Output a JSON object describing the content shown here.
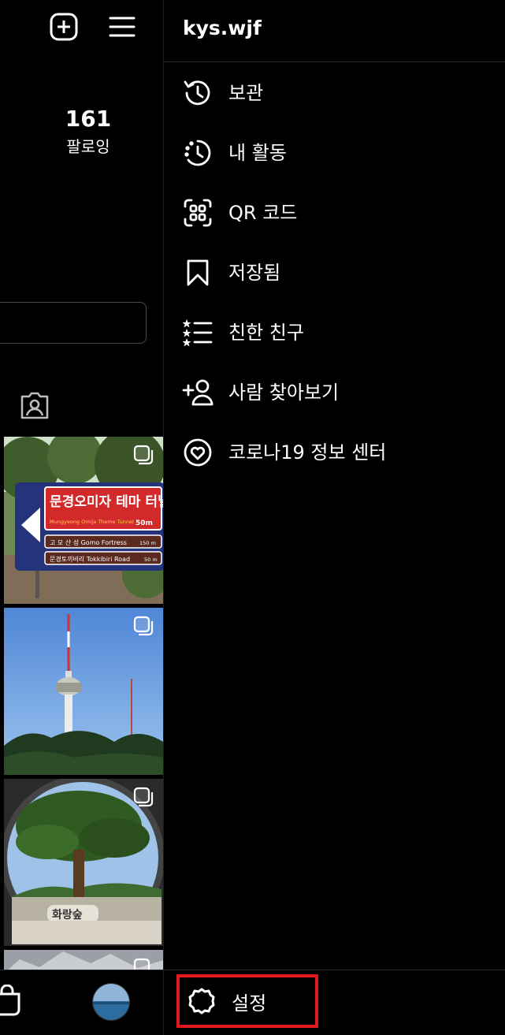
{
  "profile": {
    "following_count": "161",
    "following_label": "팔로잉"
  },
  "thumbnails": [
    {
      "name": "tunnel-sign-photo",
      "sign_title": "문경오미자 테마 터널",
      "sign_subtitle": "Mungyeong Omija Theme Tunnel",
      "sign_dist1": "50m",
      "sign_row2": "고 모 산 성  Gomo Fortress",
      "sign_dist2": "150 m",
      "sign_row3": "문경토끼비리  Tokkibiri Road",
      "sign_dist3": "50 m"
    },
    {
      "name": "tower-photo"
    },
    {
      "name": "pine-tree-photo",
      "stone_text": "화랑숲"
    },
    {
      "name": "rock-photo"
    }
  ],
  "drawer": {
    "username": "kys.wjf",
    "items": [
      {
        "label": "보관",
        "icon": "archive-icon"
      },
      {
        "label": "내 활동",
        "icon": "activity-icon"
      },
      {
        "label": "QR 코드",
        "icon": "qr-code-icon"
      },
      {
        "label": "저장됨",
        "icon": "bookmark-icon"
      },
      {
        "label": "친한 친구",
        "icon": "close-friends-icon"
      },
      {
        "label": "사람 찾아보기",
        "icon": "discover-people-icon"
      },
      {
        "label": "코로나19 정보 센터",
        "icon": "covid-info-icon"
      }
    ],
    "settings": {
      "label": "설정",
      "icon": "gear-icon"
    }
  },
  "colors": {
    "background": "#000000",
    "text": "#ffffff",
    "highlight": "#e0191e",
    "divider": "#262626"
  }
}
